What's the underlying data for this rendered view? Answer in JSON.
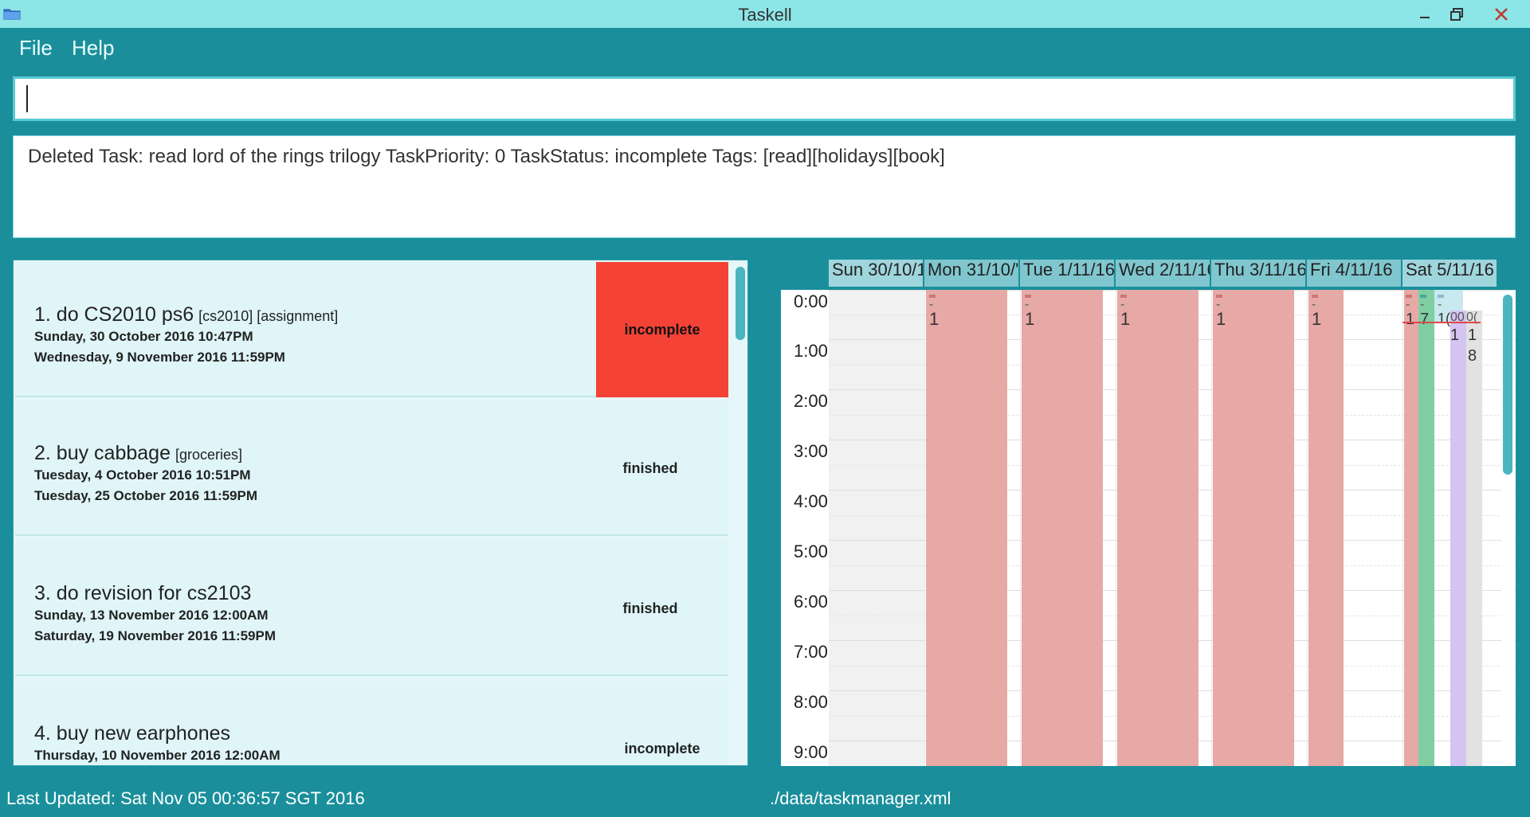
{
  "window": {
    "title": "Taskell"
  },
  "menu": {
    "file": "File",
    "help": "Help"
  },
  "command": {
    "value": "",
    "placeholder": ""
  },
  "result": {
    "text": "Deleted Task: read lord of the rings trilogy TaskPriority: 0 TaskStatus: incomplete Tags: [read][holidays][book]"
  },
  "tasks": [
    {
      "title": "1. do CS2010 ps6",
      "tags": "[cs2010] [assignment]",
      "start": "Sunday, 30 October 2016  10:47PM",
      "end": "Wednesday, 9 November 2016  11:59PM",
      "status": "incomplete"
    },
    {
      "title": "2. buy cabbage",
      "tags": "[groceries]",
      "start": "Tuesday, 4 October 2016  10:51PM",
      "end": "Tuesday, 25 October 2016  11:59PM",
      "status": "finished"
    },
    {
      "title": "3. do revision for cs2103",
      "tags": "",
      "start": "Sunday, 13 November 2016  12:00AM",
      "end": "Saturday, 19 November 2016  11:59PM",
      "status": "finished"
    },
    {
      "title": "4. buy new earphones",
      "tags": "",
      "start": "Thursday, 10 November 2016  12:00AM",
      "end": "",
      "status": "incomplete"
    }
  ],
  "calendar": {
    "days": [
      "Sun 30/10/1",
      "Mon 31/10/'",
      "Tue 1/11/16",
      "Wed 2/11/16",
      "Thu 3/11/16",
      "Fri 4/11/16",
      "Sat 5/11/16"
    ],
    "times": [
      "0:00",
      "1:00",
      "2:00",
      "3:00",
      "4:00",
      "5:00",
      "6:00",
      "7:00",
      "8:00",
      "9:00"
    ],
    "event_dash": "-",
    "event_num": "1",
    "sat_labels": {
      "a": "1",
      "b": "7",
      "c": "1(",
      "d": "00",
      "e": "0(",
      "f": "1",
      "g": "1",
      "h": "8"
    }
  },
  "status": {
    "last_updated": "Last Updated: Sat Nov 05 00:36:57 SGT 2016",
    "file_path": "./data/taskmanager.xml"
  },
  "colors": {
    "accent": "#1a8f9b",
    "titlebar": "#8ce6e8",
    "incomplete_red": "#f44336",
    "event_red": "#e6a9a6"
  }
}
